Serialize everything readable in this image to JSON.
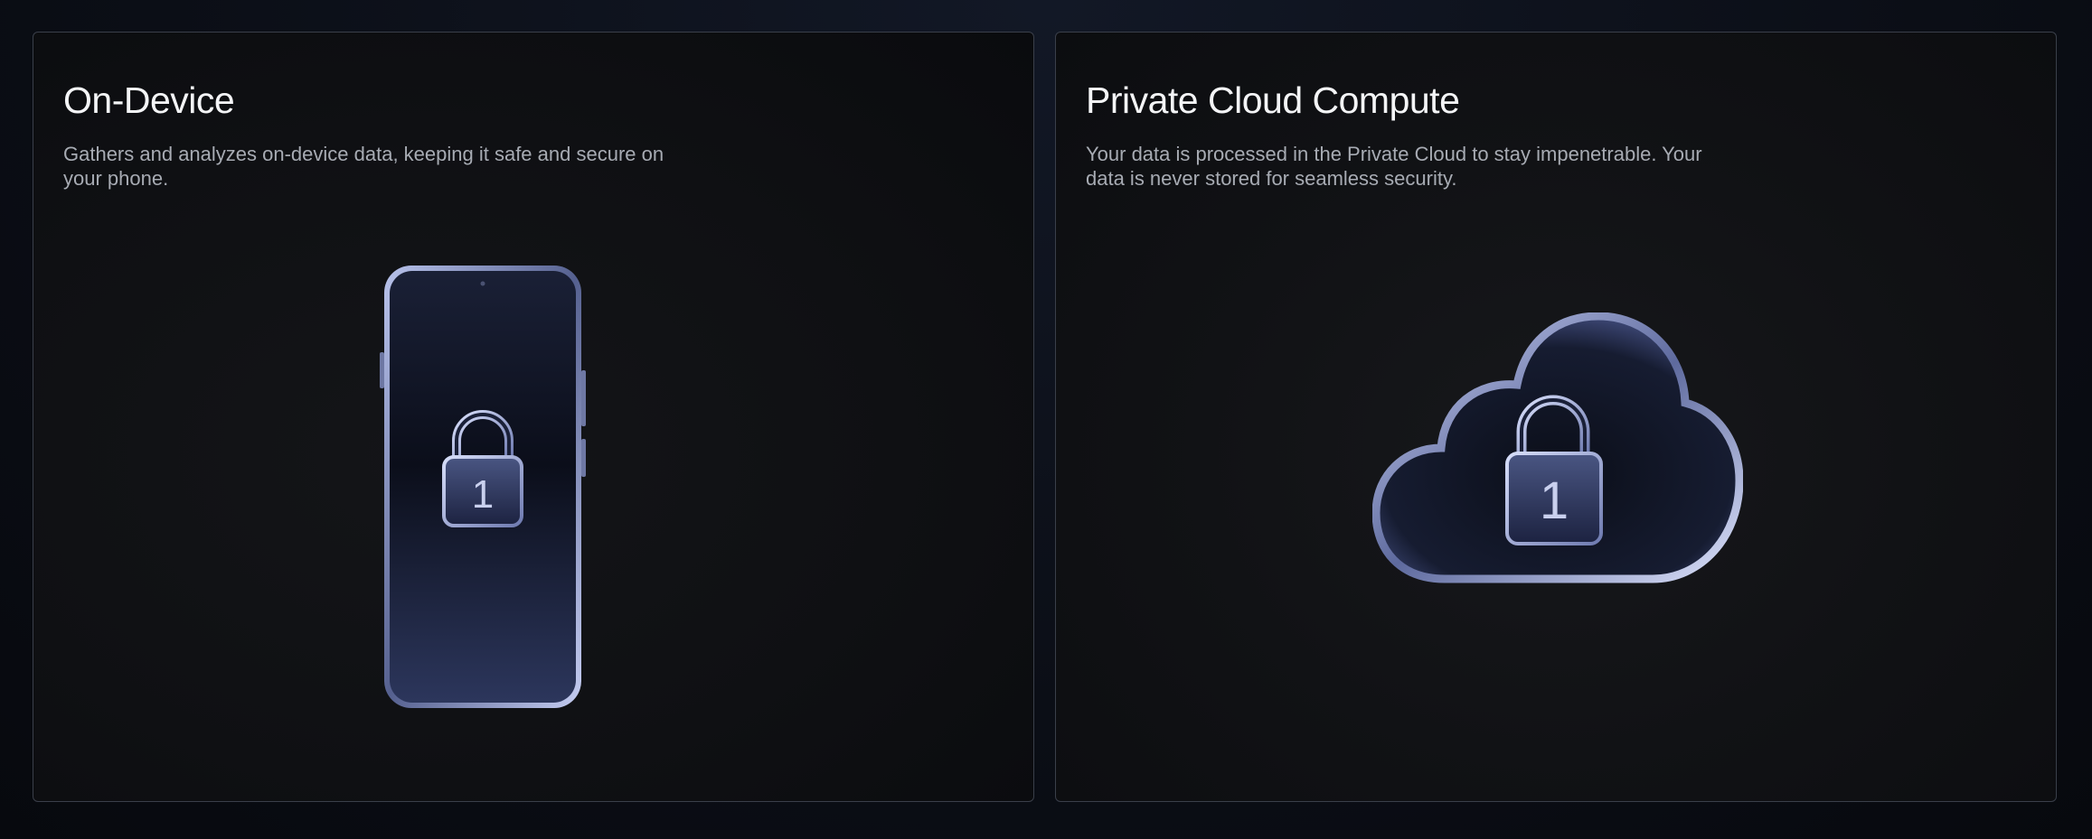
{
  "cards": [
    {
      "title": "On-Device",
      "description": "Gathers and analyzes on-device data, keeping it safe and secure on your phone.",
      "illustration": "phone-lock-icon",
      "lock_number": "1"
    },
    {
      "title": "Private Cloud Compute",
      "description": "Your data is processed in the Private Cloud to stay impenetrable. Your data is never stored for seamless security.",
      "illustration": "cloud-lock-icon",
      "lock_number": "1"
    }
  ],
  "colors": {
    "background": "#0d111a",
    "card_border": "#3a3f4a",
    "title": "#f4f5f7",
    "description": "#a7abb3",
    "glass_accent": "#8e9bd4"
  }
}
